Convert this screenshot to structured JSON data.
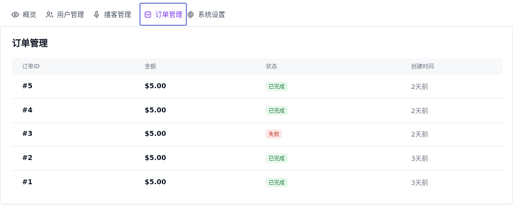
{
  "nav": {
    "tabs": [
      {
        "label": "概览",
        "icon": "eye-icon"
      },
      {
        "label": "用户管理",
        "icon": "users-icon"
      },
      {
        "label": "播客管理",
        "icon": "microphone-icon"
      },
      {
        "label": "订单管理",
        "icon": "receipt-icon",
        "active": true
      },
      {
        "label": "系统设置",
        "icon": "gear-icon"
      }
    ]
  },
  "orders": {
    "title": "订单管理",
    "columns": [
      "订单ID",
      "金额",
      "状态",
      "创建时间"
    ],
    "rows": [
      {
        "id": "#5",
        "amount": "$5.00",
        "status": "已完成",
        "status_type": "ok",
        "created": "2天前"
      },
      {
        "id": "#4",
        "amount": "$5.00",
        "status": "已完成",
        "status_type": "ok",
        "created": "2天前"
      },
      {
        "id": "#3",
        "amount": "$5.00",
        "status": "失败",
        "status_type": "fail",
        "created": "2天前"
      },
      {
        "id": "#2",
        "amount": "$5.00",
        "status": "已完成",
        "status_type": "ok",
        "created": "3天前"
      },
      {
        "id": "#1",
        "amount": "$5.00",
        "status": "已完成",
        "status_type": "ok",
        "created": "3天前"
      }
    ]
  },
  "colors": {
    "accent": "#7c3aed",
    "active_border": "#3b4fc4",
    "success_bg": "#e7f7ec",
    "success_text": "#1f7a3d",
    "fail_bg": "#fde8e8",
    "fail_text": "#c0392b"
  }
}
